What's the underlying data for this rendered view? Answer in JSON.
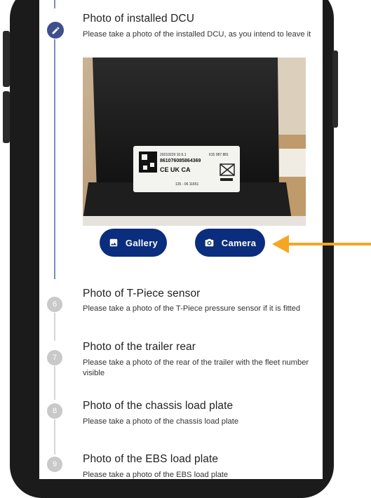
{
  "steps": {
    "current": {
      "title": "Photo of installed DCU",
      "description": "Please take a photo of the installed DCU, as you intend to leave it",
      "gallery_label": "Gallery",
      "camera_label": "Camera",
      "icon": "pencil-icon"
    },
    "items": [
      {
        "number": "6",
        "title": "Photo of T-Piece sensor",
        "description": "Please take a photo of the T-Piece pressure sensor if it is fitted"
      },
      {
        "number": "7",
        "title": "Photo of the trailer rear",
        "description": "Please take a photo of the rear of the trailer with the fleet number visible"
      },
      {
        "number": "8",
        "title": "Photo of the chassis load plate",
        "description": "Please take a photo of the chassis load plate"
      },
      {
        "number": "9",
        "title": "Photo of the EBS load plate",
        "description": "Please take a photo of the EBS load plate"
      }
    ]
  },
  "photo_label": {
    "line1": "20210229 10.6.1",
    "line2": "861076085864369",
    "part": "615 087 881",
    "marks": "CE UK CA",
    "code": "125 - 06 11651"
  },
  "colors": {
    "accent": "#0b2d7e",
    "rail_active": "#7d8bbd",
    "arrow": "#f5a623"
  }
}
